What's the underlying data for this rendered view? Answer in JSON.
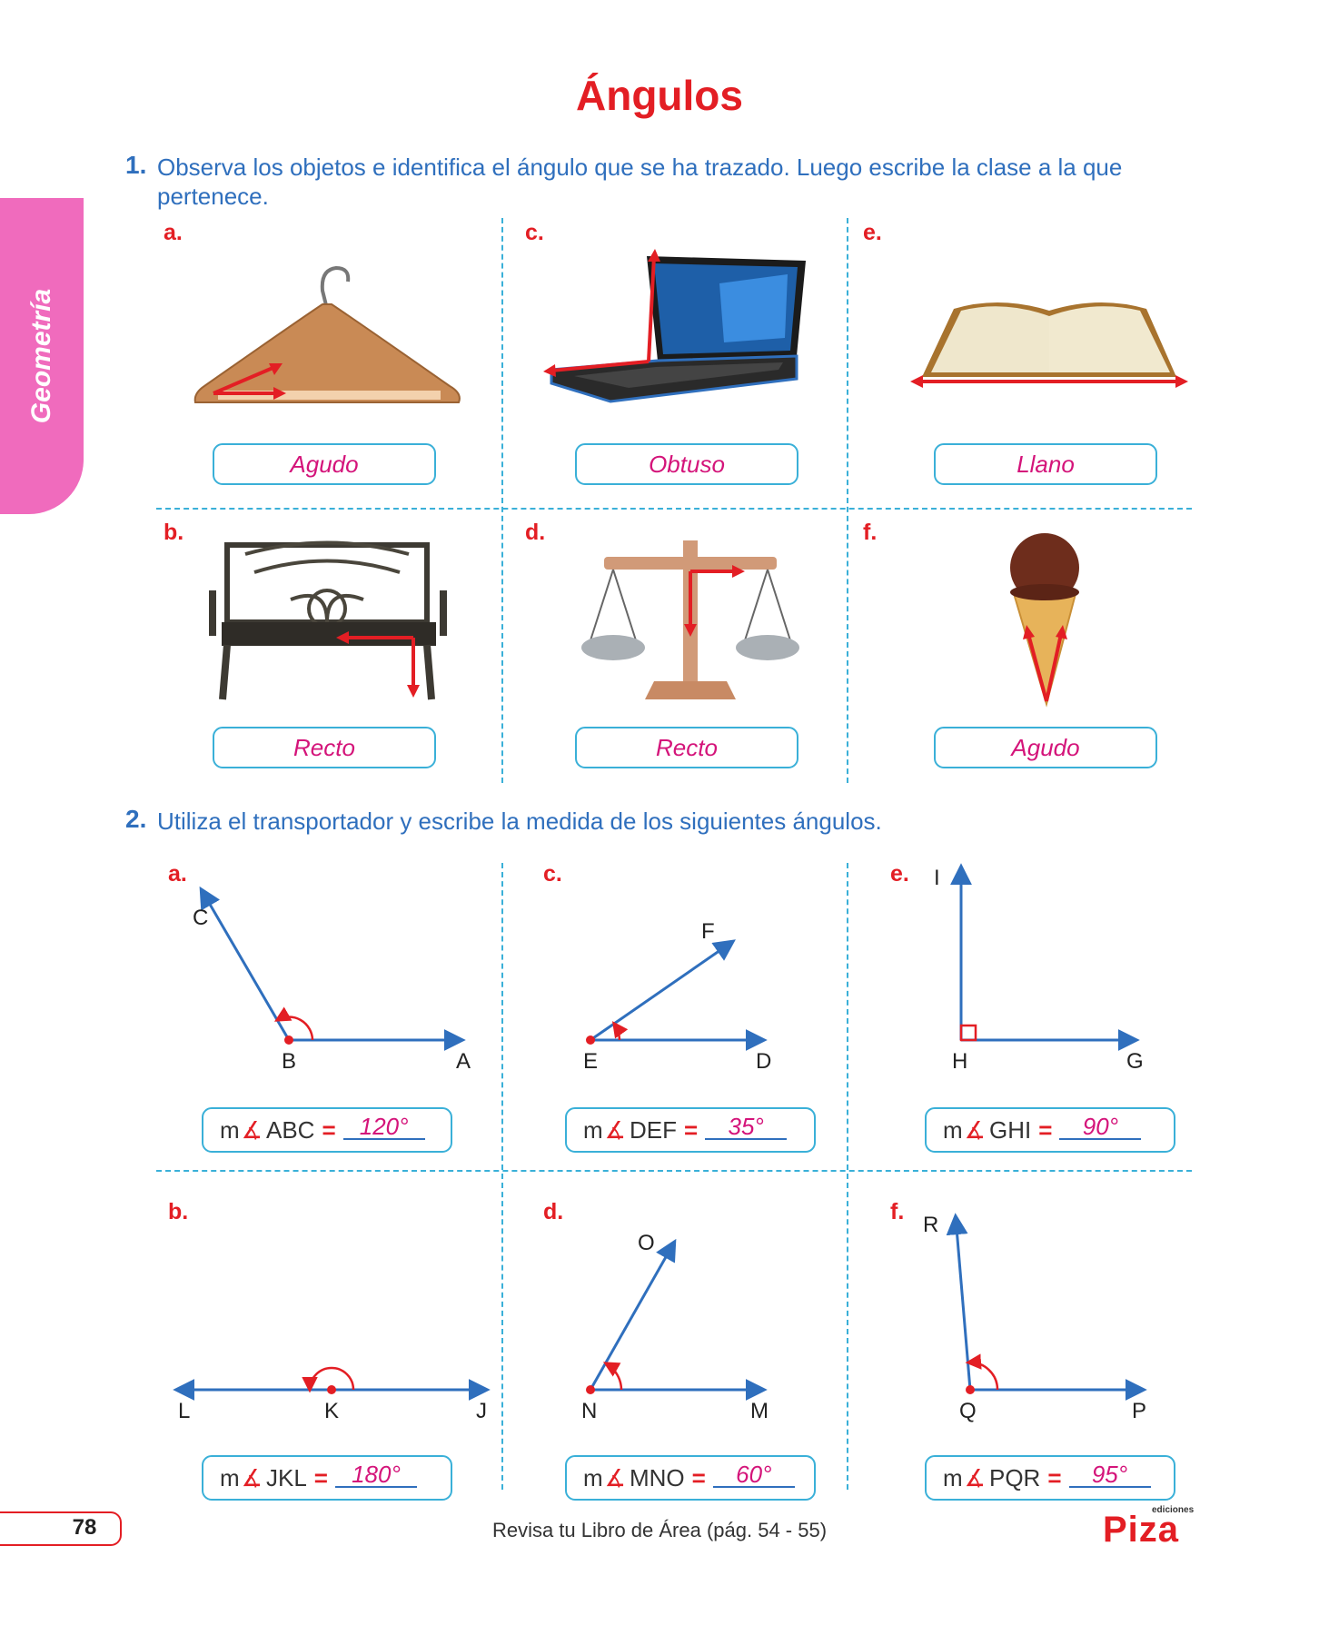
{
  "title": "Ángulos",
  "side_tab": "Geometría",
  "q1": {
    "number": "1.",
    "text": "Observa los objetos e identifica el ángulo que se ha trazado. Luego escribe la clase a la que pertenece.",
    "items": [
      {
        "letter": "a.",
        "answer": "Agudo"
      },
      {
        "letter": "c.",
        "answer": "Obtuso"
      },
      {
        "letter": "e.",
        "answer": "Llano"
      },
      {
        "letter": "b.",
        "answer": "Recto"
      },
      {
        "letter": "d.",
        "answer": "Recto"
      },
      {
        "letter": "f.",
        "answer": "Agudo"
      }
    ]
  },
  "q2": {
    "number": "2.",
    "text": "Utiliza el transportador y escribe la medida de los siguientes ángulos.",
    "items": [
      {
        "letter": "a.",
        "m": "m",
        "name": "ABC",
        "eq": "=",
        "value": "120°",
        "p1": "C",
        "vertex": "B",
        "p2": "A"
      },
      {
        "letter": "c.",
        "m": "m",
        "name": "DEF",
        "eq": "=",
        "value": "35°",
        "p1": "F",
        "vertex": "E",
        "p2": "D"
      },
      {
        "letter": "e.",
        "m": "m",
        "name": "GHI",
        "eq": "=",
        "value": "90°",
        "p1": "I",
        "vertex": "H",
        "p2": "G"
      },
      {
        "letter": "b.",
        "m": "m",
        "name": "JKL",
        "eq": "=",
        "value": "180°",
        "p1": "L",
        "vertex": "K",
        "p2": "J"
      },
      {
        "letter": "d.",
        "m": "m",
        "name": "MNO",
        "eq": "=",
        "value": "60°",
        "p1": "O",
        "vertex": "N",
        "p2": "M"
      },
      {
        "letter": "f.",
        "m": "m",
        "name": "PQR",
        "eq": "=",
        "value": "95°",
        "p1": "R",
        "vertex": "Q",
        "p2": "P"
      }
    ]
  },
  "footer": {
    "page_number": "78",
    "note": "Revisa tu Libro de Área (pág. 54 - 55)",
    "brand_small": "ediciones",
    "brand": "Piza"
  }
}
